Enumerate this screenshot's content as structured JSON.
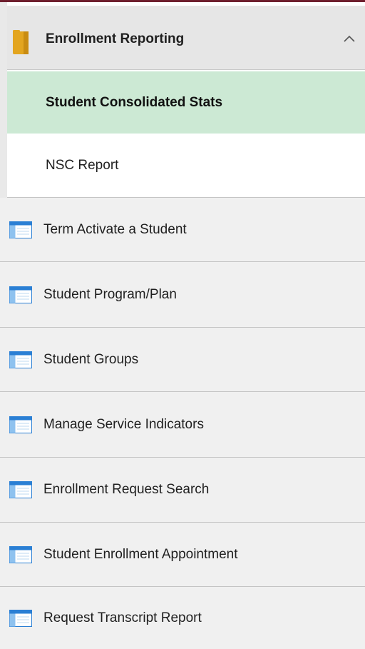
{
  "group": {
    "title": "Enrollment Reporting",
    "icon": "folder-icon",
    "chevron": "chevron-up-icon",
    "folder_color": "#e3a51f",
    "items": [
      {
        "label": "Student Consolidated Stats",
        "selected": true
      },
      {
        "label": "NSC Report",
        "selected": false
      }
    ]
  },
  "menu": {
    "icon": "component-page-icon",
    "items": [
      {
        "label": "Term Activate a Student"
      },
      {
        "label": "Student Program/Plan"
      },
      {
        "label": "Student Groups"
      },
      {
        "label": "Manage Service Indicators"
      },
      {
        "label": "Enrollment Request Search"
      },
      {
        "label": "Student Enrollment Appointment"
      },
      {
        "label": "Request Transcript Report"
      }
    ]
  },
  "colors": {
    "accent_rule": "#6e1f2e",
    "selected_bg": "#cce9d4",
    "header_bg": "#e6e6e6",
    "item_bg": "#f0f0f0",
    "icon_blue": "#2a7fd4"
  }
}
